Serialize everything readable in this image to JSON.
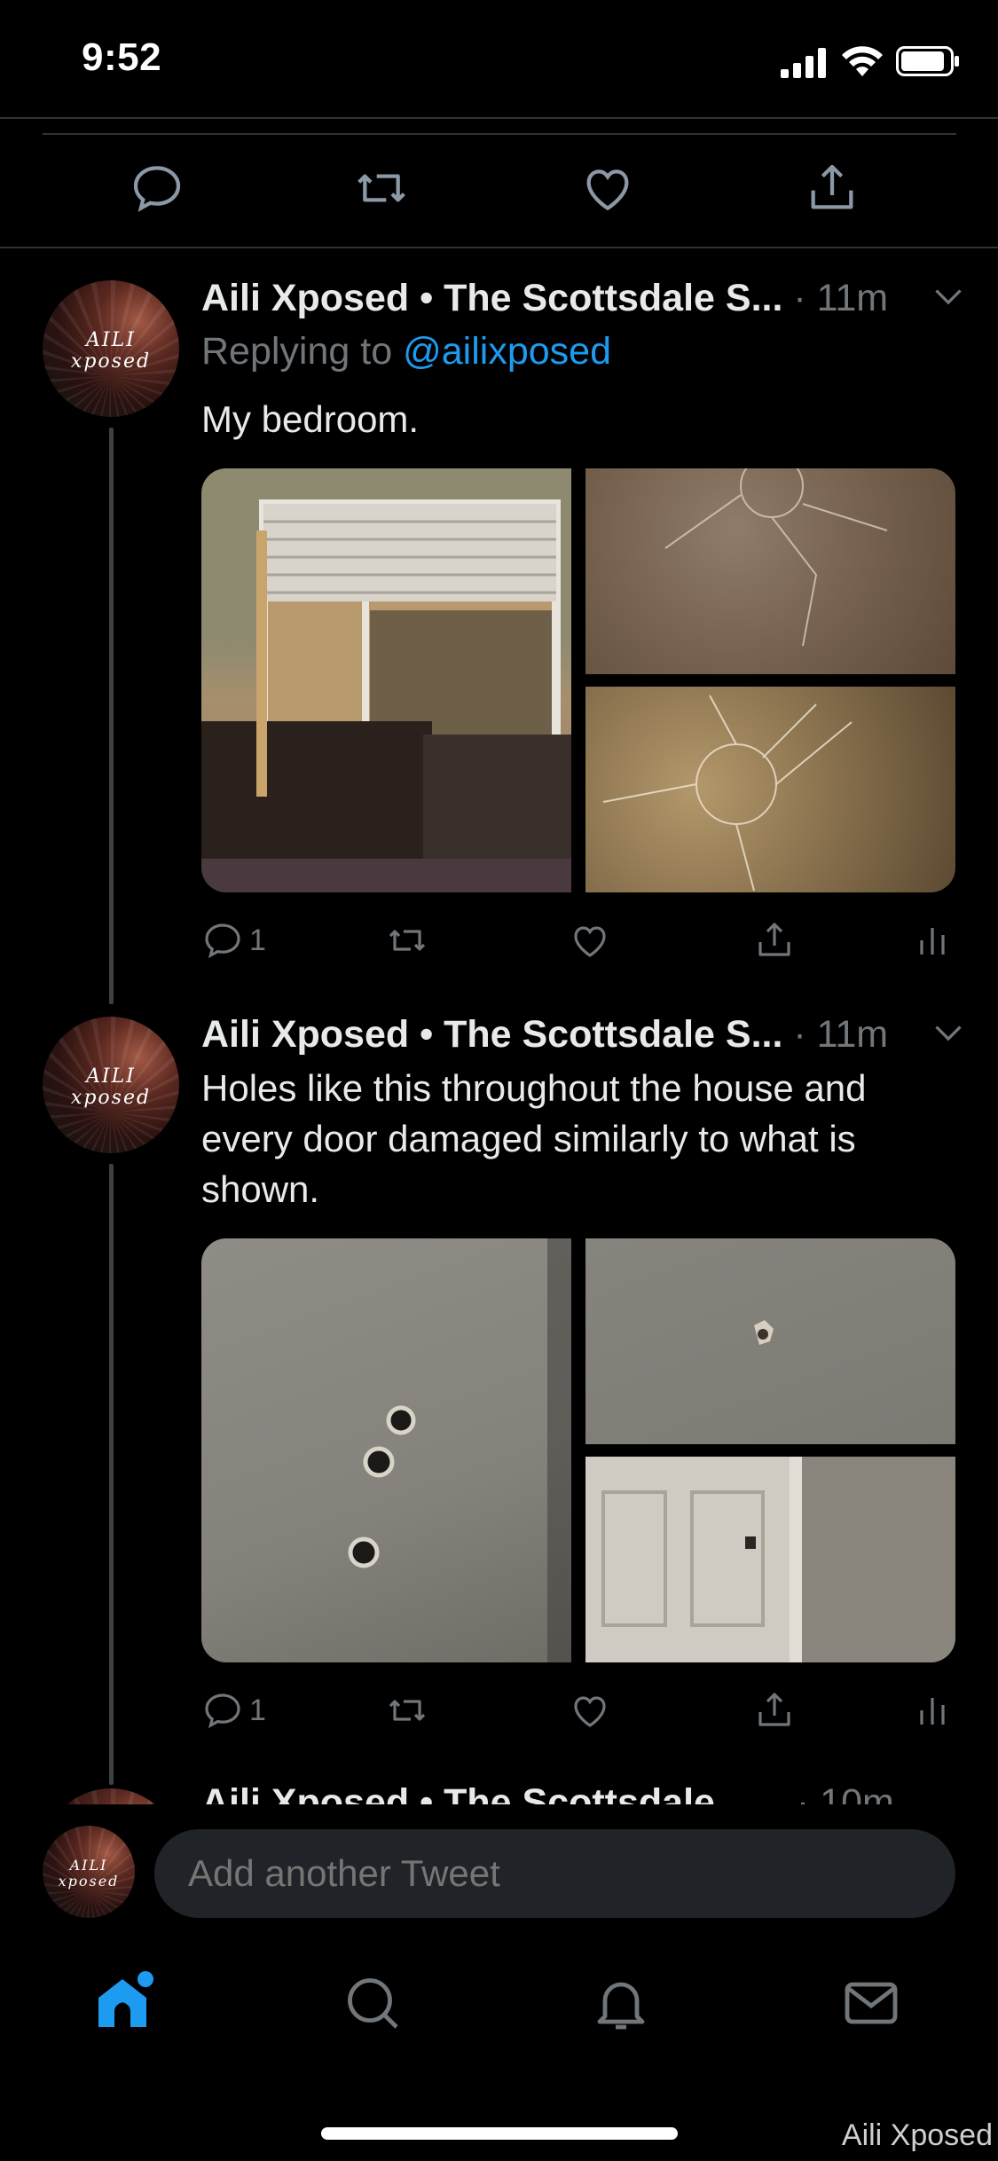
{
  "status_bar": {
    "time": "9:52"
  },
  "tweets": [
    {
      "author": "Aili Xposed • The Scottsdale S...",
      "time": "· 11m",
      "reply_prefix": "Replying to",
      "reply_handle": "@ailixposed",
      "text": "My bedroom.",
      "replies": "1"
    },
    {
      "author": "Aili Xposed • The Scottsdale S...",
      "time": "· 11m",
      "text": "Holes like this throughout the house and every door damaged similarly to what is shown.",
      "replies": "1"
    },
    {
      "author": "Aili Xposed • The Scottsdale",
      "time": "· 10m"
    }
  ],
  "avatar_text": "AILI xposed",
  "compose": {
    "placeholder": "Add another Tweet"
  },
  "tabbar": [
    "home-icon",
    "search-icon",
    "notifications-icon",
    "messages-icon"
  ],
  "watermark": "Aili Xposed",
  "colors": {
    "accent": "#1d9bf0",
    "muted": "#71767b",
    "background": "#000000"
  }
}
